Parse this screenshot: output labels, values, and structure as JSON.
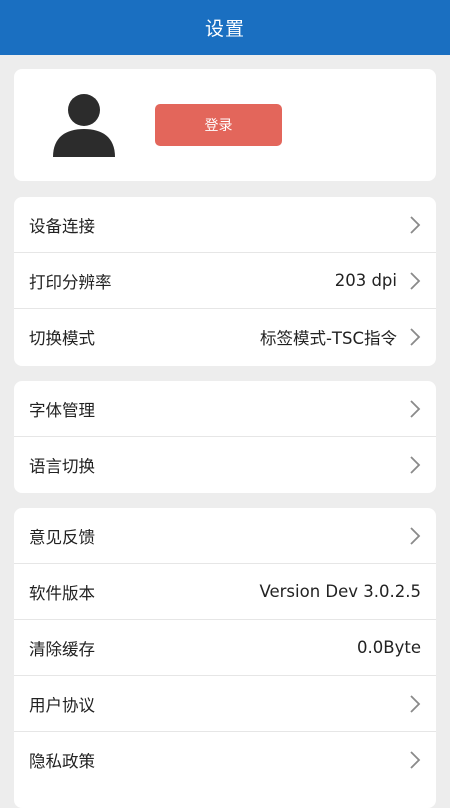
{
  "header": {
    "title": "设置"
  },
  "profile": {
    "avatar_icon": "user-avatar-icon",
    "login_label": "登录"
  },
  "device_section": {
    "items": [
      {
        "label": "设备连接",
        "value": ""
      },
      {
        "label": "打印分辨率",
        "value": "203 dpi"
      },
      {
        "label": "切换模式",
        "value": "标签模式-TSC指令"
      }
    ]
  },
  "font_section": {
    "items": [
      {
        "label": "字体管理"
      },
      {
        "label": "语言切换"
      }
    ]
  },
  "misc_section": {
    "items": [
      {
        "label": "意见反馈",
        "value": ""
      },
      {
        "label": "软件版本",
        "value": "Version Dev 3.0.2.5"
      },
      {
        "label": "清除缓存",
        "value": "0.0Byte"
      },
      {
        "label": "用户协议",
        "value": ""
      },
      {
        "label": "隐私政策",
        "value": ""
      }
    ]
  },
  "colors": {
    "header_bg": "#1a6fc1",
    "login_button_bg": "#e3665b",
    "page_bg": "#ededed",
    "chevron": "#8a8a8a"
  }
}
